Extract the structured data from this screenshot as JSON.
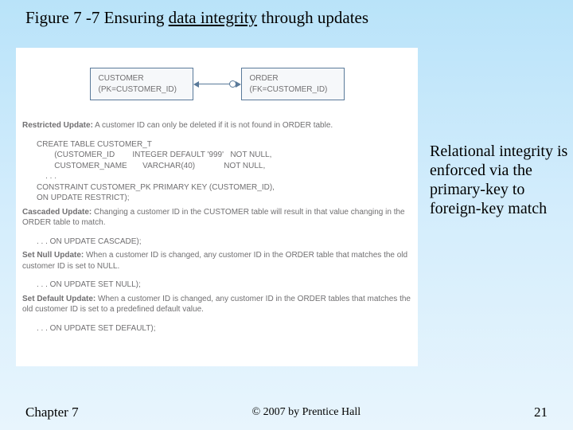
{
  "title_a": "Figure 7 -7 Ensuring ",
  "title_u": "data integrity",
  "title_b": " through updates",
  "customer_box_l1": "CUSTOMER",
  "customer_box_l2": "(PK=CUSTOMER_ID)",
  "order_box_l1": "ORDER",
  "order_box_l2": "(FK=CUSTOMER_ID)",
  "restricted_t": "Restricted Update:",
  "restricted_d": " A customer ID can only be deleted if it is not found in ORDER table.",
  "sql_create": "CREATE TABLE CUSTOMER_T\n        (CUSTOMER_ID        INTEGER DEFAULT '999'   NOT NULL,\n        CUSTOMER_NAME       VARCHAR(40)             NOT NULL,\n    . . .\nCONSTRAINT CUSTOMER_PK PRIMARY KEY (CUSTOMER_ID),\nON UPDATE RESTRICT);",
  "cascaded_t": "Cascaded Update:",
  "cascaded_d": " Changing a customer ID in the CUSTOMER table will result in that value changing in the ORDER table to match.",
  "sql_cascade": ". . . ON UPDATE CASCADE);",
  "setnull_t": "Set Null Update:",
  "setnull_d": " When a customer ID is changed, any customer ID in the ORDER table that matches the old customer ID is set to NULL.",
  "sql_setnull": ". . . ON UPDATE SET NULL);",
  "setdefault_t": "Set Default Update:",
  "setdefault_d": " When a customer ID is changed, any customer ID in the ORDER tables that matches the old customer ID is set to a predefined default value.",
  "sql_setdefault": ". . . ON UPDATE SET DEFAULT);",
  "annotation": "Relational integrity is enforced via the primary-key to foreign-key match",
  "chapter": "Chapter 7",
  "copyright": "© 2007 by Prentice Hall",
  "page": "21"
}
